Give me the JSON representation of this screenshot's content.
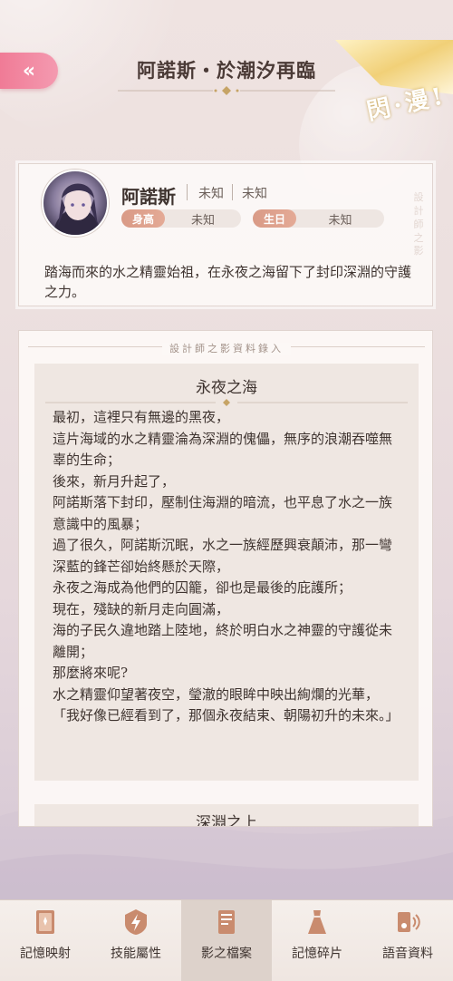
{
  "header": {
    "back_label": "«",
    "title": "阿諾斯・於潮汐再臨",
    "badge_text": "閃·漫!"
  },
  "profile": {
    "name": "阿諾斯",
    "meta1": "未知",
    "meta2": "未知",
    "height_label": "身高",
    "height_value": "未知",
    "birthday_label": "生日",
    "birthday_value": "未知",
    "watermark": "設計師之影",
    "description": "踏海而來的水之精靈始祖，在永夜之海留下了封印深淵的守護之力。"
  },
  "record": {
    "section_title": "設計師之影資料錄入",
    "story_title": "永夜之海",
    "story_lines": [
      "最初，這裡只有無邊的黑夜，",
      "這片海域的水之精靈淪為深淵的傀儡，無序的浪潮吞噬無辜的生命；",
      "後來，新月升起了，",
      "阿諾斯落下封印，壓制住海淵的暗流，也平息了水之一族意識中的風暴；",
      "過了很久，阿諾斯沉眠，水之一族經歷興衰顛沛，那一彎深藍的鋒芒卻始終懸於天際，",
      "永夜之海成為他們的囚籠，卻也是最後的庇護所；",
      "現在，殘缺的新月走向圓滿，",
      "海的子民久違地踏上陸地，終於明白水之神靈的守護從未離開；",
      "那麼將來呢?",
      "水之精靈仰望著夜空，瑩澈的眼眸中映出絢爛的光華，",
      "「我好像已經看到了，那個永夜結束、朝陽初升的未來。」"
    ],
    "next_story_title": "深淵之上"
  },
  "nav": {
    "items": [
      {
        "label": "記憶映射",
        "icon": "memory-card-icon"
      },
      {
        "label": "技能屬性",
        "icon": "lightning-shield-icon"
      },
      {
        "label": "影之檔案",
        "icon": "document-icon"
      },
      {
        "label": "記憶碎片",
        "icon": "dress-icon"
      },
      {
        "label": "語音資料",
        "icon": "voice-icon"
      }
    ],
    "active_index": 2
  },
  "colors": {
    "accent_pink": "#f07b96",
    "tag_color": "#d99a86",
    "gold": "#c8a24c"
  }
}
